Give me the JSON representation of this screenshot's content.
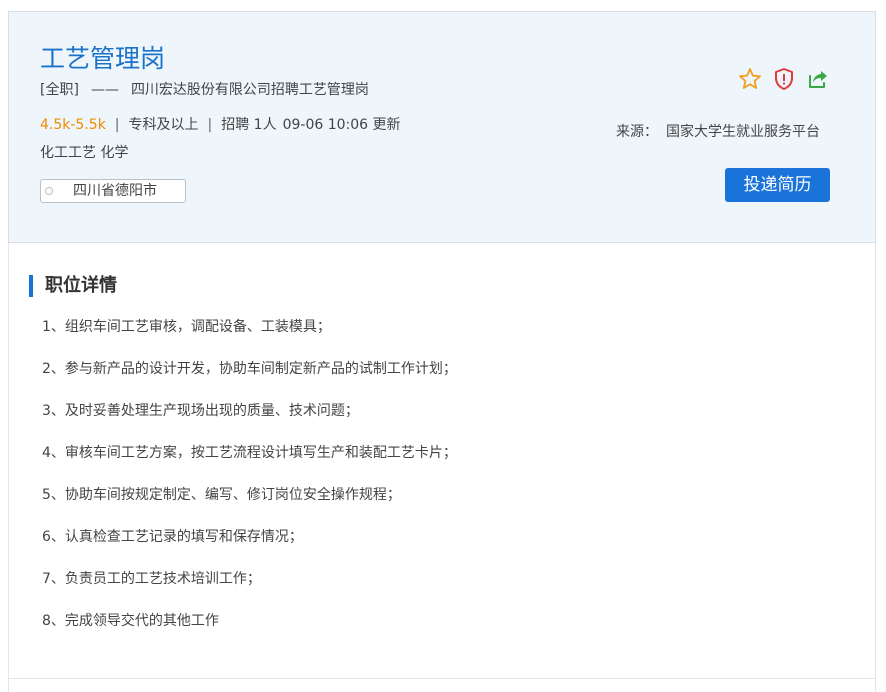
{
  "job": {
    "title": "工艺管理岗",
    "type_tag": "[全职]",
    "dash": "——",
    "headline": "四川宏达股份有限公司招聘工艺管理岗",
    "salary": "4.5k-5.5k",
    "education": "专科及以上",
    "headcount": "招聘 1人",
    "updated": "09-06 10:06 更新",
    "separator": "|",
    "majors": "化工工艺 化学",
    "location": "四川省德阳市",
    "source_label": "来源：",
    "source_name": "国家大学生就业服务平台",
    "apply_label": "投递简历"
  },
  "icons": {
    "favorite": "star-icon",
    "report": "shield-icon",
    "share": "share-icon"
  },
  "colors": {
    "accent": "#1a73d9",
    "title": "#1a73c9",
    "salary": "#f08a00",
    "star": "#f0a020",
    "report": "#e03a3a",
    "share": "#3aa845",
    "header_bg": "#eef5fb"
  },
  "detail": {
    "heading": "职位详情",
    "duties": [
      "1、组织车间工艺审核，调配设备、工装模具；",
      "2、参与新产品的设计开发，协助车间制定新产品的试制工作计划；",
      "3、及时妥善处理生产现场出现的质量、技术问题；",
      "4、审核车间工艺方案，按工艺流程设计填写生产和装配工艺卡片；",
      "5、协助车间按规定制定、编写、修订岗位安全操作规程；",
      "6、认真检查工艺记录的填写和保存情况；",
      "7、负责员工的工艺技术培训工作；",
      "8、完成领导交代的其他工作"
    ]
  }
}
